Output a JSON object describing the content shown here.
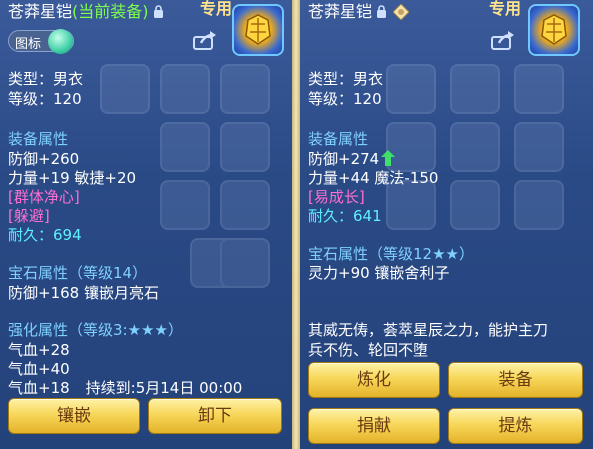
{
  "left": {
    "title": "苍莽星铠",
    "current_tag": "(当前装备)",
    "exclusive": "专用",
    "toggle_label": "图标",
    "type_line": "类型：男衣",
    "level_line": "等级：120",
    "equip_attr_header": "装备属性",
    "defense_line": "防御+260",
    "str_agi_line": "力量+19 敏捷+20",
    "special1": "[群体净心]",
    "special2": "[躲避]",
    "durability_label": "耐久：",
    "durability_value": "694",
    "gem_header": "宝石属性（等级14）",
    "gem_line": "防御+168 镶嵌月亮石",
    "enhance_header": "强化属性（等级3:★★★）",
    "hp1": "气血+28",
    "hp2": "气血+40",
    "hp3": "气血+18",
    "duration": "持续到:5月14日 00:00",
    "btn_inlay": "镶嵌",
    "btn_unequip": "卸下"
  },
  "right": {
    "title": "苍莽星铠",
    "exclusive": "专用",
    "type_line": "类型：男衣",
    "level_line": "等级：120",
    "equip_attr_header": "装备属性",
    "defense_line": "防御+274",
    "str_mag_line": "力量+44 魔法-150",
    "special1": "[易成长]",
    "durability_label": "耐久：",
    "durability_value": "641",
    "gem_header": "宝石属性（等级12★★）",
    "gem_line": "灵力+90 镶嵌舍利子",
    "desc_line1": "其威无俦，荟萃星辰之力，能护主刀",
    "desc_line2": "兵不伤、轮回不堕",
    "btn_refine": "炼化",
    "btn_equip": "装备",
    "btn_donate": "捐献",
    "btn_extract": "提炼"
  },
  "colors": {
    "header": "#7fd0ff",
    "current": "#7dff4a",
    "special_pink": "#ff6ed0",
    "durability": "#5ff0ff",
    "button": "#f7d75a",
    "button_text": "#6a3a10"
  },
  "icons": [
    "lock-icon",
    "armor-icon",
    "share-icon",
    "toggle-knob",
    "up-arrow-icon",
    "diamond-badge-icon"
  ]
}
